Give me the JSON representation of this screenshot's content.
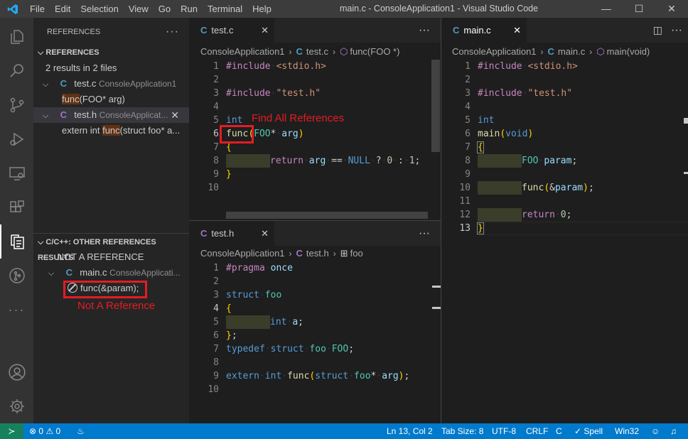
{
  "titlebar": {
    "menu": [
      "File",
      "Edit",
      "Selection",
      "View",
      "Go",
      "Run",
      "Terminal",
      "Help"
    ],
    "window_title": "main.c - ConsoleApplication1 - Visual Studio Code",
    "controls": [
      "—",
      "☐",
      "✕"
    ]
  },
  "activity": [
    "files-icon",
    "search-icon",
    "source-control-icon",
    "run-debug-icon",
    "remote-explorer-icon",
    "extensions-icon",
    "references-icon",
    "git-graph-icon",
    "more-icon",
    "account-icon",
    "settings-gear-icon"
  ],
  "sidebar": {
    "header": "REFERENCES",
    "section_title": "REFERENCES",
    "summary": "2 results in 2 files",
    "files": [
      {
        "icon": "C",
        "name": "test.c",
        "project": "ConsoleApplication1",
        "match_pre": "",
        "match": "func",
        "match_post": "(FOO* arg)"
      },
      {
        "icon": "C",
        "name": "test.h",
        "project": "ConsoleApplicat...",
        "match_pre": "extern int ",
        "match": "func",
        "match_post": "(struct foo* a..."
      }
    ],
    "other_title": "C/C++: OTHER REFERENCES RESULTS",
    "not_ref_label": "NOT A REFERENCE",
    "other_file": {
      "icon": "C",
      "name": "main.c",
      "project": "ConsoleApplicati..."
    },
    "other_match": "func(&param);"
  },
  "editor_left_top": {
    "tab_icon": "C",
    "tab": "test.c",
    "crumbs": [
      "ConsoleApplication1",
      "test.c",
      "func(FOO *)"
    ],
    "crumb_icon": "C"
  },
  "editor_left_bottom": {
    "tab_icon": "C",
    "tab": "test.h",
    "crumbs": [
      "ConsoleApplication1",
      "test.h",
      "foo"
    ],
    "crumb_icon": "C"
  },
  "editor_right": {
    "tab_icon": "C",
    "tab": "main.c",
    "crumbs": [
      "ConsoleApplication1",
      "main.c",
      "main(void)"
    ],
    "crumb_icon": "C"
  },
  "code_text": {
    "include": "#include",
    "stdio": "<stdio.h>",
    "testh": "\"test.h\"",
    "int": "int",
    "func": "func",
    "foo_upper": "FOO",
    "arg": "arg",
    "return": "return",
    "null": "NULL",
    "zero": "0",
    "one": "1",
    "pragma": "#pragma",
    "once": "once",
    "struct": "struct",
    "foo": "foo",
    "a": "a",
    "typedef": "typedef",
    "extern": "extern",
    "main": "main",
    "void": "void",
    "param": "param"
  },
  "annotations": {
    "find_all": "Find All References",
    "not_a_ref": "Not A Reference"
  },
  "status": {
    "errors": "0",
    "warnings": "0",
    "position": "Ln 13, Col 2",
    "tab_size": "Tab Size: 8",
    "encoding": "UTF-8",
    "eol": "CRLF",
    "language": "C",
    "spell": "✓ Spell",
    "platform": "Win32"
  },
  "colors": {
    "status_bar": "#007acc",
    "remote": "#16825d",
    "annotation": "#e51c23"
  }
}
